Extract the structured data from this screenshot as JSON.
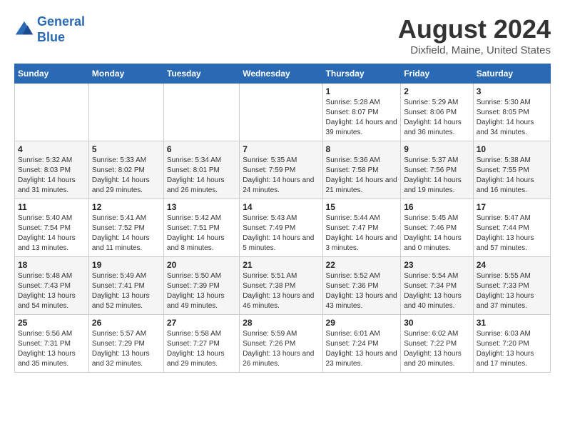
{
  "logo": {
    "line1": "General",
    "line2": "Blue"
  },
  "title": "August 2024",
  "subtitle": "Dixfield, Maine, United States",
  "days_of_week": [
    "Sunday",
    "Monday",
    "Tuesday",
    "Wednesday",
    "Thursday",
    "Friday",
    "Saturday"
  ],
  "weeks": [
    [
      {
        "day": "",
        "sunrise": "",
        "sunset": "",
        "daylight": ""
      },
      {
        "day": "",
        "sunrise": "",
        "sunset": "",
        "daylight": ""
      },
      {
        "day": "",
        "sunrise": "",
        "sunset": "",
        "daylight": ""
      },
      {
        "day": "",
        "sunrise": "",
        "sunset": "",
        "daylight": ""
      },
      {
        "day": "1",
        "sunrise": "Sunrise: 5:28 AM",
        "sunset": "Sunset: 8:07 PM",
        "daylight": "Daylight: 14 hours and 39 minutes."
      },
      {
        "day": "2",
        "sunrise": "Sunrise: 5:29 AM",
        "sunset": "Sunset: 8:06 PM",
        "daylight": "Daylight: 14 hours and 36 minutes."
      },
      {
        "day": "3",
        "sunrise": "Sunrise: 5:30 AM",
        "sunset": "Sunset: 8:05 PM",
        "daylight": "Daylight: 14 hours and 34 minutes."
      }
    ],
    [
      {
        "day": "4",
        "sunrise": "Sunrise: 5:32 AM",
        "sunset": "Sunset: 8:03 PM",
        "daylight": "Daylight: 14 hours and 31 minutes."
      },
      {
        "day": "5",
        "sunrise": "Sunrise: 5:33 AM",
        "sunset": "Sunset: 8:02 PM",
        "daylight": "Daylight: 14 hours and 29 minutes."
      },
      {
        "day": "6",
        "sunrise": "Sunrise: 5:34 AM",
        "sunset": "Sunset: 8:01 PM",
        "daylight": "Daylight: 14 hours and 26 minutes."
      },
      {
        "day": "7",
        "sunrise": "Sunrise: 5:35 AM",
        "sunset": "Sunset: 7:59 PM",
        "daylight": "Daylight: 14 hours and 24 minutes."
      },
      {
        "day": "8",
        "sunrise": "Sunrise: 5:36 AM",
        "sunset": "Sunset: 7:58 PM",
        "daylight": "Daylight: 14 hours and 21 minutes."
      },
      {
        "day": "9",
        "sunrise": "Sunrise: 5:37 AM",
        "sunset": "Sunset: 7:56 PM",
        "daylight": "Daylight: 14 hours and 19 minutes."
      },
      {
        "day": "10",
        "sunrise": "Sunrise: 5:38 AM",
        "sunset": "Sunset: 7:55 PM",
        "daylight": "Daylight: 14 hours and 16 minutes."
      }
    ],
    [
      {
        "day": "11",
        "sunrise": "Sunrise: 5:40 AM",
        "sunset": "Sunset: 7:54 PM",
        "daylight": "Daylight: 14 hours and 13 minutes."
      },
      {
        "day": "12",
        "sunrise": "Sunrise: 5:41 AM",
        "sunset": "Sunset: 7:52 PM",
        "daylight": "Daylight: 14 hours and 11 minutes."
      },
      {
        "day": "13",
        "sunrise": "Sunrise: 5:42 AM",
        "sunset": "Sunset: 7:51 PM",
        "daylight": "Daylight: 14 hours and 8 minutes."
      },
      {
        "day": "14",
        "sunrise": "Sunrise: 5:43 AM",
        "sunset": "Sunset: 7:49 PM",
        "daylight": "Daylight: 14 hours and 5 minutes."
      },
      {
        "day": "15",
        "sunrise": "Sunrise: 5:44 AM",
        "sunset": "Sunset: 7:47 PM",
        "daylight": "Daylight: 14 hours and 3 minutes."
      },
      {
        "day": "16",
        "sunrise": "Sunrise: 5:45 AM",
        "sunset": "Sunset: 7:46 PM",
        "daylight": "Daylight: 14 hours and 0 minutes."
      },
      {
        "day": "17",
        "sunrise": "Sunrise: 5:47 AM",
        "sunset": "Sunset: 7:44 PM",
        "daylight": "Daylight: 13 hours and 57 minutes."
      }
    ],
    [
      {
        "day": "18",
        "sunrise": "Sunrise: 5:48 AM",
        "sunset": "Sunset: 7:43 PM",
        "daylight": "Daylight: 13 hours and 54 minutes."
      },
      {
        "day": "19",
        "sunrise": "Sunrise: 5:49 AM",
        "sunset": "Sunset: 7:41 PM",
        "daylight": "Daylight: 13 hours and 52 minutes."
      },
      {
        "day": "20",
        "sunrise": "Sunrise: 5:50 AM",
        "sunset": "Sunset: 7:39 PM",
        "daylight": "Daylight: 13 hours and 49 minutes."
      },
      {
        "day": "21",
        "sunrise": "Sunrise: 5:51 AM",
        "sunset": "Sunset: 7:38 PM",
        "daylight": "Daylight: 13 hours and 46 minutes."
      },
      {
        "day": "22",
        "sunrise": "Sunrise: 5:52 AM",
        "sunset": "Sunset: 7:36 PM",
        "daylight": "Daylight: 13 hours and 43 minutes."
      },
      {
        "day": "23",
        "sunrise": "Sunrise: 5:54 AM",
        "sunset": "Sunset: 7:34 PM",
        "daylight": "Daylight: 13 hours and 40 minutes."
      },
      {
        "day": "24",
        "sunrise": "Sunrise: 5:55 AM",
        "sunset": "Sunset: 7:33 PM",
        "daylight": "Daylight: 13 hours and 37 minutes."
      }
    ],
    [
      {
        "day": "25",
        "sunrise": "Sunrise: 5:56 AM",
        "sunset": "Sunset: 7:31 PM",
        "daylight": "Daylight: 13 hours and 35 minutes."
      },
      {
        "day": "26",
        "sunrise": "Sunrise: 5:57 AM",
        "sunset": "Sunset: 7:29 PM",
        "daylight": "Daylight: 13 hours and 32 minutes."
      },
      {
        "day": "27",
        "sunrise": "Sunrise: 5:58 AM",
        "sunset": "Sunset: 7:27 PM",
        "daylight": "Daylight: 13 hours and 29 minutes."
      },
      {
        "day": "28",
        "sunrise": "Sunrise: 5:59 AM",
        "sunset": "Sunset: 7:26 PM",
        "daylight": "Daylight: 13 hours and 26 minutes."
      },
      {
        "day": "29",
        "sunrise": "Sunrise: 6:01 AM",
        "sunset": "Sunset: 7:24 PM",
        "daylight": "Daylight: 13 hours and 23 minutes."
      },
      {
        "day": "30",
        "sunrise": "Sunrise: 6:02 AM",
        "sunset": "Sunset: 7:22 PM",
        "daylight": "Daylight: 13 hours and 20 minutes."
      },
      {
        "day": "31",
        "sunrise": "Sunrise: 6:03 AM",
        "sunset": "Sunset: 7:20 PM",
        "daylight": "Daylight: 13 hours and 17 minutes."
      }
    ]
  ]
}
